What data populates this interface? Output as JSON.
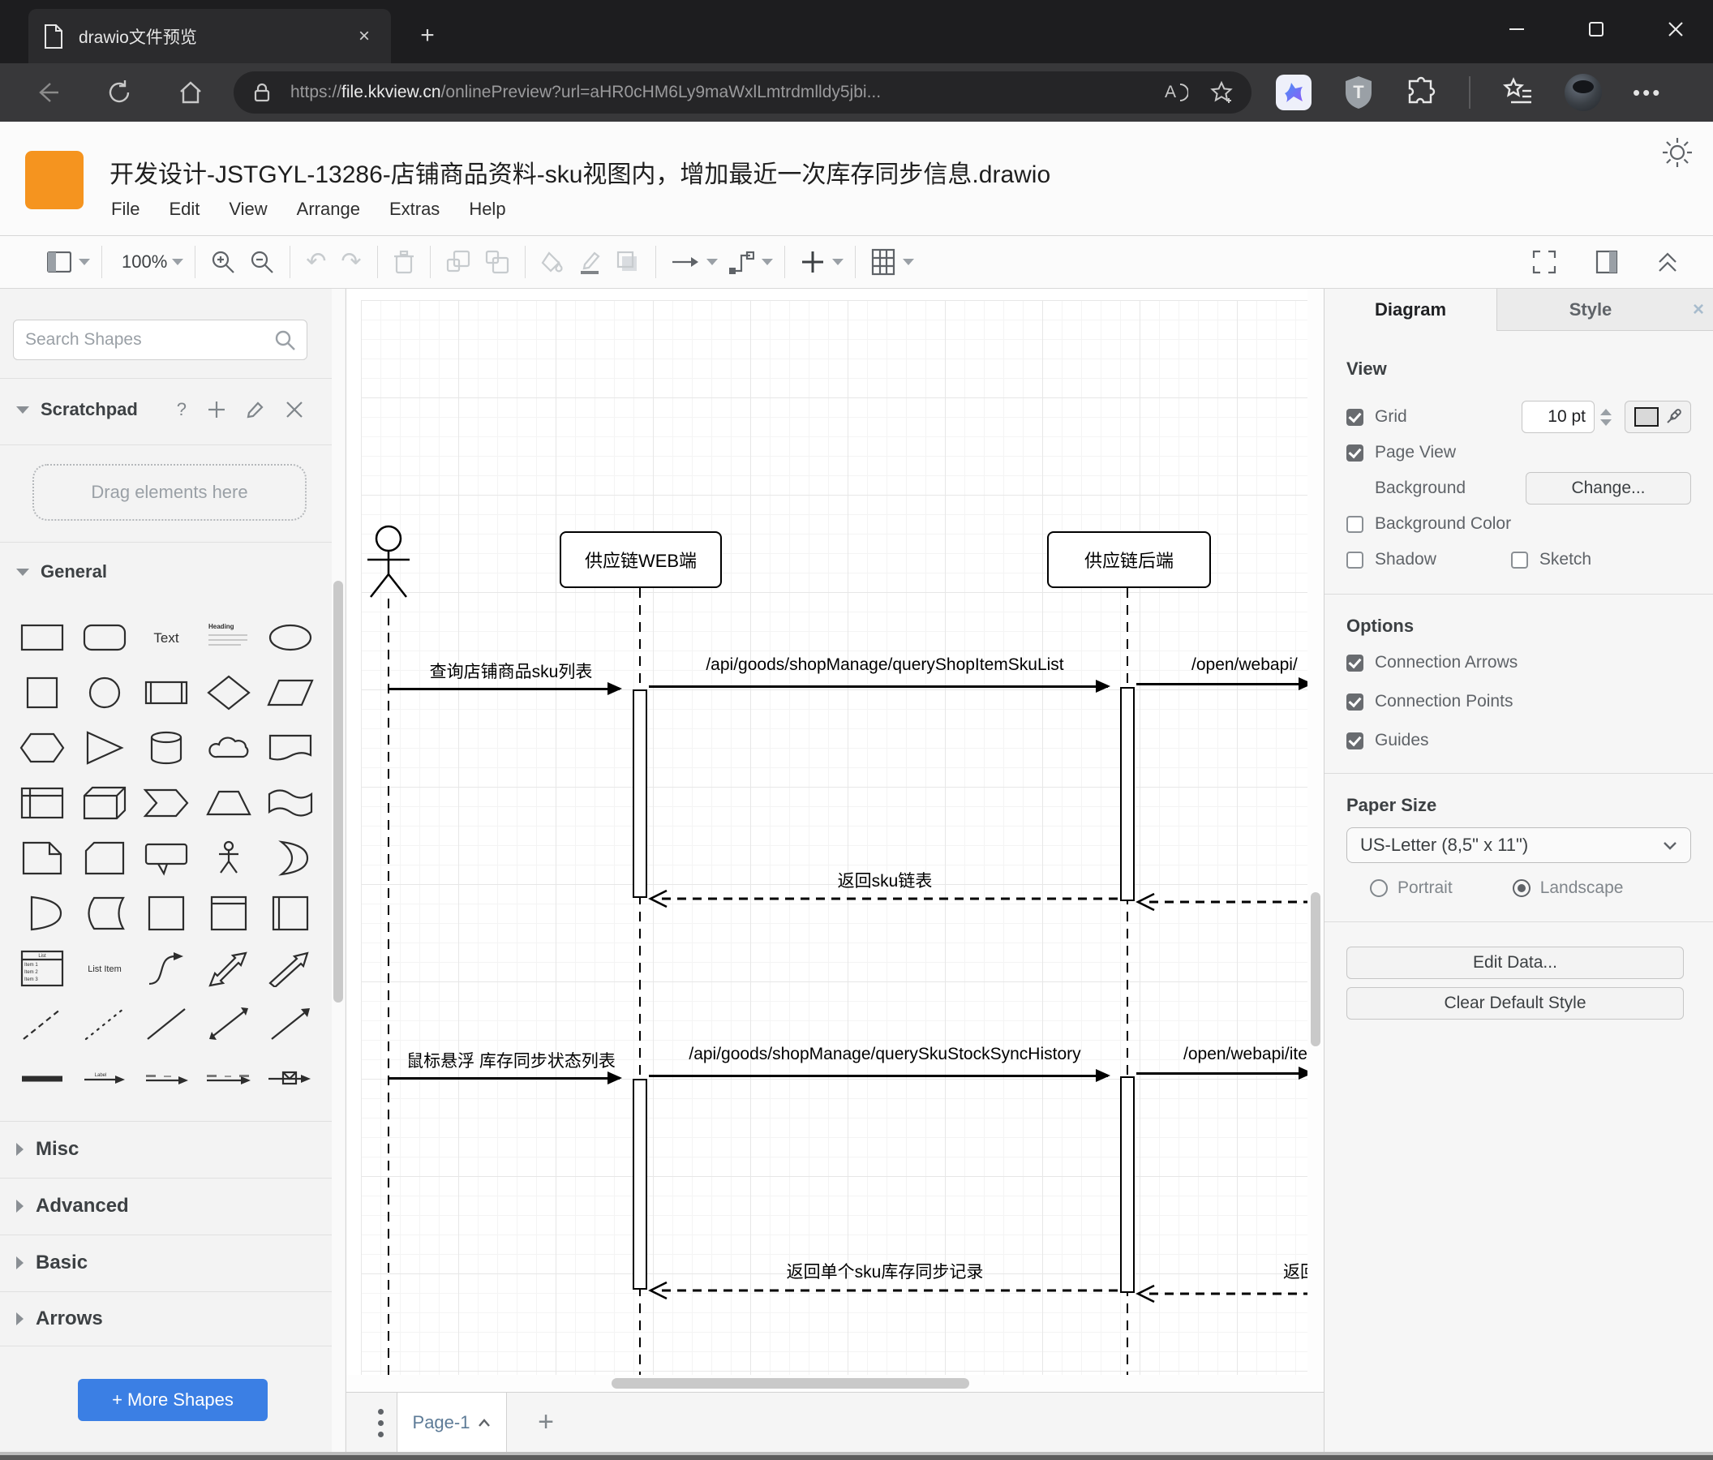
{
  "browser": {
    "tab_title": "drawio文件预览",
    "url_scheme": "https://",
    "url_domain": "file.kkview.cn",
    "url_path": "/onlinePreview?url=aHR0cHM6Ly9maWxlLmtrdmlldy5jbi...",
    "read_aloud_letter": "A",
    "shield_letter": "T"
  },
  "app": {
    "title": "开发设计-JSTGYL-13286-店铺商品资料-sku视图内，增加最近一次库存同步信息.drawio",
    "menus": {
      "file": "File",
      "edit": "Edit",
      "view": "View",
      "arrange": "Arrange",
      "extras": "Extras",
      "help": "Help"
    },
    "zoom_level": "100%"
  },
  "sidebar": {
    "search_placeholder": "Search Shapes",
    "scratchpad_title": "Scratchpad",
    "scratchpad_help": "?",
    "scratchpad_hint": "Drag elements here",
    "sections": {
      "general": "General",
      "misc": "Misc",
      "advanced": "Advanced",
      "basic": "Basic",
      "arrows": "Arrows"
    },
    "more_shapes": "+ More Shapes",
    "shape_text": {
      "text": "Text",
      "heading": "Heading",
      "list": "List",
      "item1": "Item 1",
      "item2": "Item 2",
      "item3": "Item 3",
      "list_item": "List Item",
      "label": "Label"
    }
  },
  "canvas": {
    "participants": {
      "web": "供应链WEB端",
      "backend": "供应链后端"
    },
    "messages": {
      "m1": "查询店铺商品sku列表",
      "m2": "/api/goods/shopManage/queryShopItemSkuList",
      "m3": "/open/webapi/",
      "r1": "返回sku链表",
      "m4": "鼠标悬浮 库存同步状态列表",
      "m5": "/api/goods/shopManage/querySkuStockSyncHistory",
      "m6": "/open/webapi/item",
      "r2": "返回单个sku库存同步记录",
      "r3": "返回"
    },
    "page_tab": "Page-1"
  },
  "panel": {
    "tab_diagram": "Diagram",
    "tab_style": "Style",
    "view_heading": "View",
    "grid_label": "Grid",
    "grid_size": "10 pt",
    "page_view": "Page View",
    "background": "Background",
    "change": "Change...",
    "background_color": "Background Color",
    "shadow": "Shadow",
    "sketch": "Sketch",
    "options_heading": "Options",
    "connection_arrows": "Connection Arrows",
    "connection_points": "Connection Points",
    "guides": "Guides",
    "paper_heading": "Paper Size",
    "paper_size": "US-Letter (8,5\" x 11\")",
    "portrait": "Portrait",
    "landscape": "Landscape",
    "edit_data": "Edit Data...",
    "clear_default_style": "Clear Default Style"
  },
  "colors": {
    "accent_blue": "#3b7fe4",
    "logo_orange": "#f5941f",
    "chrome_dark": "#1d1d1f"
  }
}
